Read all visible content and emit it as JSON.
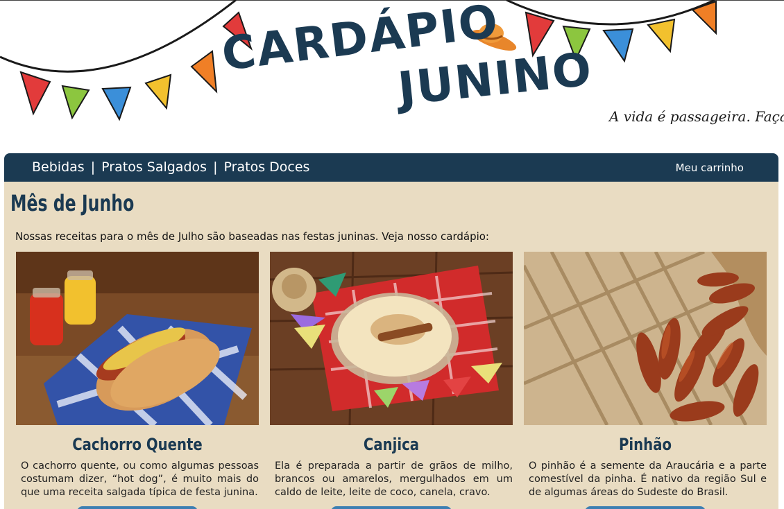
{
  "header": {
    "logo_line1": "CARDÁPIO",
    "logo_line2": "JUNINO",
    "tagline": "A vida é passageira. Faça o"
  },
  "nav": {
    "links": [
      "Bebidas",
      "Pratos Salgados",
      "Pratos Doces"
    ],
    "separator": "|",
    "cart_label": "Meu carrinho"
  },
  "main": {
    "title": "Mês de Junho",
    "intro": "Nossas receitas para o mês de Julho são baseadas nas festas juninas. Veja nosso cardápio:",
    "cards": [
      {
        "title": "Cachorro Quente",
        "description": " O cachorro quente, ou como algumas pessoas costumam dizer, “hot dog”, é muito mais do que uma receita salgada típica de festa junina."
      },
      {
        "title": "Canjica",
        "description": " Ela é preparada a partir de grãos de milho, brancos ou amarelos, mergulhados em um caldo de leite, leite de coco, canela, cravo."
      },
      {
        "title": "Pinhão",
        "description": " O pinhão é a semente da Araucária e a parte comestível da pinha. É nativo da região Sul e de algumas áreas do Sudeste do Brasil."
      }
    ]
  },
  "colors": {
    "navy": "#1b3a52",
    "beige": "#e9dcc2",
    "button_blue": "#3d7fb2"
  }
}
